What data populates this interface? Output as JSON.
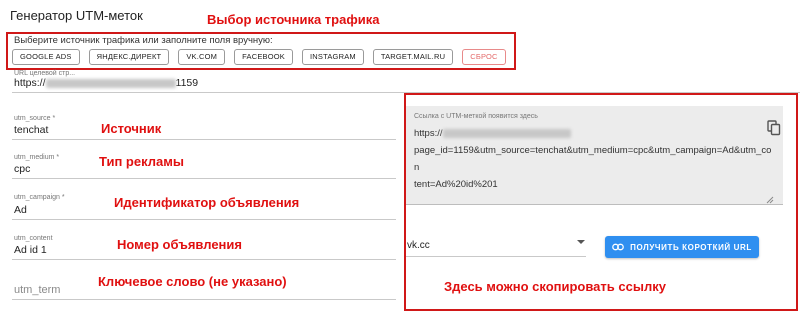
{
  "title": "Генератор UTM-меток",
  "annotations": {
    "traffic_source": "Выбор источника трафика",
    "source": "Источник",
    "ad_type": "Тип рекламы",
    "ad_id": "Идентификатор объявления",
    "ad_number": "Номер объявления",
    "keyword": "Ключевое слово (не указано)",
    "copy_here": "Здесь можно скопировать ссылку"
  },
  "source_picker": {
    "hint": "Выберите источник трафика или заполните поля вручную:",
    "buttons": [
      "GOOGLE ADS",
      "ЯНДЕКС.ДИРЕКТ",
      "VK.COM",
      "FACEBOOK",
      "INSTAGRAM",
      "TARGET.MAIL.RU"
    ],
    "reset": "СБРОС"
  },
  "url_field": {
    "label": "URL целевой стр...",
    "value_start": "https://",
    "value_end": "1159"
  },
  "fields": {
    "utm_source": {
      "label": "utm_source *",
      "value": "tenchat"
    },
    "utm_medium": {
      "label": "utm_medium *",
      "value": "cpc"
    },
    "utm_campaign": {
      "label": "utm_campaign *",
      "value": "Ad"
    },
    "utm_content": {
      "label": "utm_content",
      "value": "Ad id 1"
    },
    "utm_term": {
      "placeholder": "utm_term"
    }
  },
  "result": {
    "label": "Ссылка с UTM-меткой появится здесь",
    "line1_start": "https://",
    "line2": "page_id=1159&utm_source=tenchat&utm_medium=cpc&utm_campaign=Ad&utm_con",
    "line3": "tent=Ad%20id%201"
  },
  "shortener": {
    "selected": "vk.cc",
    "button_label": "ПОЛУЧИТЬ КОРОТКИЙ URL"
  },
  "colors": {
    "annotation": "#e01010",
    "accent": "#2f8ff0",
    "reset": "#e46a6a"
  }
}
